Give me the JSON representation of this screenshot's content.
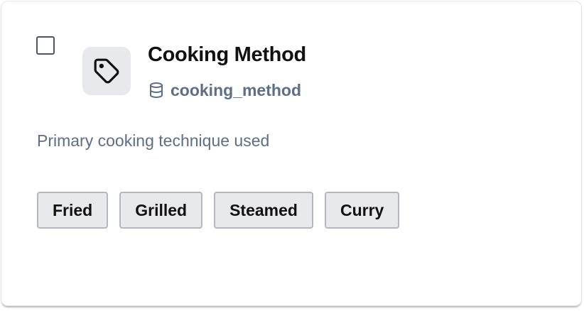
{
  "card": {
    "title": "Cooking Method",
    "field_name": "cooking_method",
    "description": "Primary cooking technique used",
    "icons": {
      "tile": "tag-icon",
      "field": "database-icon"
    },
    "options": [
      {
        "label": "Fried"
      },
      {
        "label": "Grilled"
      },
      {
        "label": "Steamed"
      },
      {
        "label": "Curry"
      }
    ],
    "selected": false
  },
  "colors": {
    "title": "#111111",
    "muted": "#5f6e84",
    "chip_bg": "#e8e9ec",
    "chip_border": "#b4b8be",
    "icon_tile_bg": "#e8e9ec"
  }
}
